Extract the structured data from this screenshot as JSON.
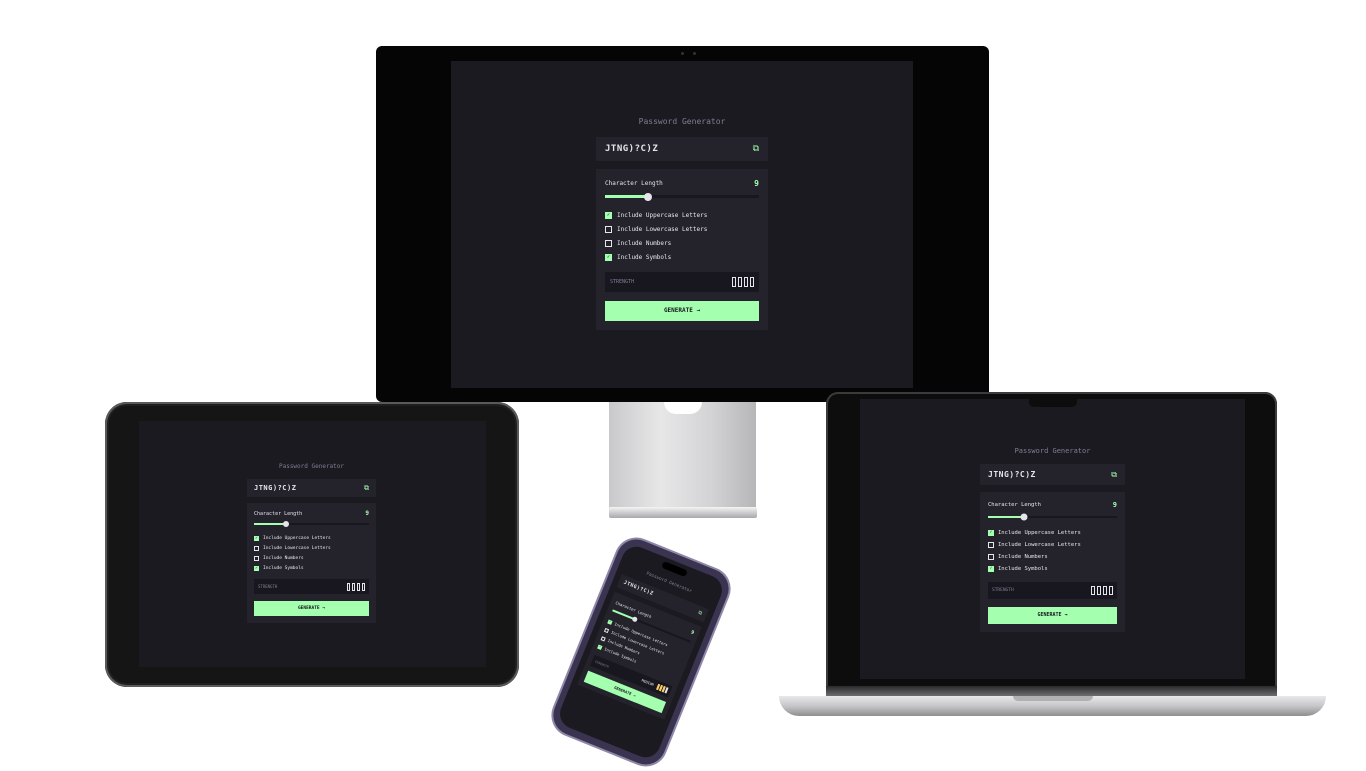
{
  "app": {
    "title": "Password Generator",
    "password": "JTNG)?C)Z",
    "length_label": "Character Length",
    "length_value": "9",
    "length_fraction": 0.28,
    "options": [
      {
        "label": "Include Uppercase Letters",
        "checked": true
      },
      {
        "label": "Include Lowercase Letters",
        "checked": false
      },
      {
        "label": "Include Numbers",
        "checked": false
      },
      {
        "label": "Include Symbols",
        "checked": true
      }
    ],
    "strength_label": "STRENGTH",
    "strength_level_text": "MEDIUM",
    "strength_bars_filled": 3,
    "generate_label": "GENERATE →"
  },
  "icons": {
    "copy": "copy-icon",
    "check": "checkmark-icon"
  },
  "colors": {
    "accent": "#a4ffaf",
    "background": "#18171f",
    "panel": "#24232c",
    "text": "#e6e5ea",
    "muted": "#817d92",
    "medium_strength": "#f8cd65"
  }
}
